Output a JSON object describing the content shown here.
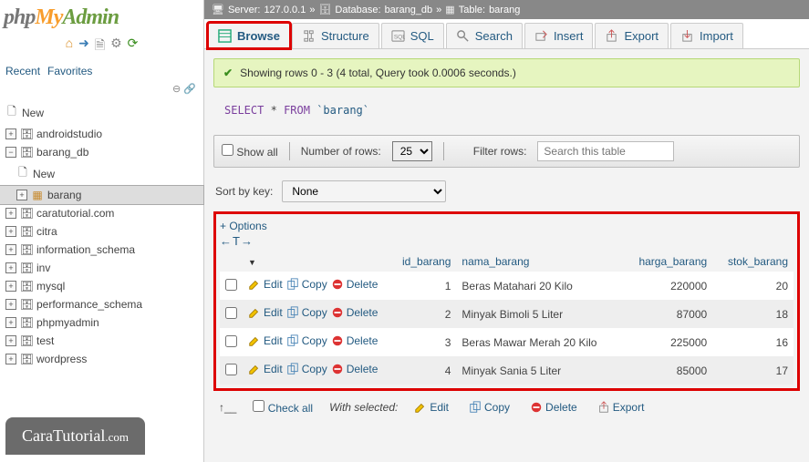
{
  "logo": {
    "php": "php",
    "my": "My",
    "admin": "Admin"
  },
  "miniTabs": {
    "recent": "Recent",
    "favorites": "Favorites"
  },
  "tree": {
    "new": "New",
    "dbs": [
      "androidstudio",
      "barang_db",
      "caratutorial.com",
      "citra",
      "information_schema",
      "inv",
      "mysql",
      "performance_schema",
      "phpmyadmin",
      "test",
      "wordpress"
    ],
    "barangdb_new": "New",
    "barangdb_table": "barang"
  },
  "breadcrumb": {
    "server_lbl": "Server:",
    "server": "127.0.0.1",
    "db_lbl": "Database:",
    "db": "barang_db",
    "table_lbl": "Table:",
    "table": "barang"
  },
  "tabs": {
    "browse": "Browse",
    "structure": "Structure",
    "sql": "SQL",
    "search": "Search",
    "insert": "Insert",
    "export": "Export",
    "import": "Import"
  },
  "msg": "Showing rows 0 - 3 (4 total, Query took 0.0006 seconds.)",
  "sql": {
    "select": "SELECT",
    "star": "*",
    "from": "FROM",
    "table": "`barang`"
  },
  "toolbar": {
    "showall": "Show all",
    "numrows_lbl": "Number of rows:",
    "numrows_val": "25",
    "filter_lbl": "Filter rows:",
    "filter_ph": "Search this table"
  },
  "sort": {
    "label": "Sort by key:",
    "value": "None"
  },
  "options": "+ Options",
  "columns": {
    "id": "id_barang",
    "nama": "nama_barang",
    "harga": "harga_barang",
    "stok": "stok_barang"
  },
  "actions": {
    "edit": "Edit",
    "copy": "Copy",
    "delete": "Delete"
  },
  "rows": [
    {
      "id": "1",
      "nama": "Beras Matahari 20 Kilo",
      "harga": "220000",
      "stok": "20"
    },
    {
      "id": "2",
      "nama": "Minyak Bimoli 5 Liter",
      "harga": "87000",
      "stok": "18"
    },
    {
      "id": "3",
      "nama": "Beras Mawar Merah 20 Kilo",
      "harga": "225000",
      "stok": "16"
    },
    {
      "id": "4",
      "nama": "Minyak Sania 5 Liter",
      "harga": "85000",
      "stok": "17"
    }
  ],
  "footer": {
    "checkall": "Check all",
    "withsel": "With selected:",
    "edit": "Edit",
    "copy": "Copy",
    "delete": "Delete",
    "export": "Export"
  },
  "badge": {
    "main": "CaraTutorial",
    "suffix": ".com"
  }
}
